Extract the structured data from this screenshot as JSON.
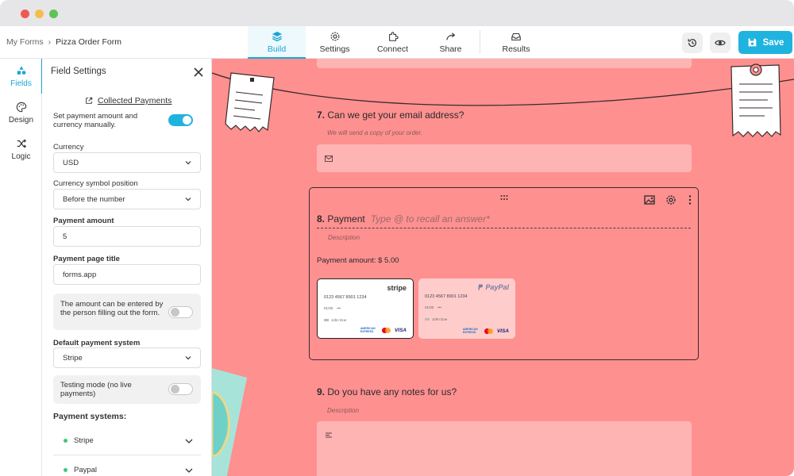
{
  "breadcrumb": {
    "root": "My Forms",
    "separator": "›",
    "current": "Pizza Order Form"
  },
  "tabs": [
    {
      "label": "Build",
      "icon": "stack-icon"
    },
    {
      "label": "Settings",
      "icon": "gear-icon"
    },
    {
      "label": "Connect",
      "icon": "puzzle-icon"
    },
    {
      "label": "Share",
      "icon": "share-arrow-icon"
    },
    {
      "label": "Results",
      "icon": "inbox-icon"
    }
  ],
  "save_label": "Save",
  "rail": [
    {
      "label": "Fields",
      "icon": "shapes-icon"
    },
    {
      "label": "Design",
      "icon": "palette-icon"
    },
    {
      "label": "Logic",
      "icon": "shuffle-icon"
    }
  ],
  "panel": {
    "title": "Field Settings",
    "collected_link": "Collected Payments",
    "manual_toggle_label": "Set payment amount and currency manually.",
    "currency_label": "Currency",
    "currency_value": "USD",
    "symbol_label": "Currency symbol position",
    "symbol_value": "Before the number",
    "amount_label": "Payment amount",
    "amount_value": "5",
    "page_title_label": "Payment page title",
    "page_title_value": "forms.app",
    "person_amount_label": "The amount can be entered by the person filling out the form.",
    "default_system_label": "Default payment system",
    "default_system_value": "Stripe",
    "testing_label": "Testing mode (no live payments)",
    "systems_label": "Payment systems:",
    "systems": [
      "Stripe",
      "Paypal"
    ]
  },
  "form": {
    "q7_number": "7.",
    "q7_title": "Can we get your email address?",
    "q7_desc": "We will send a copy of your order.",
    "q8_number": "8.",
    "q8_title": "Payment",
    "q8_placeholder": "Type @ to recall an answer*",
    "q8_desc": "Description",
    "q8_amount": "Payment amount: $ 5.00",
    "q9_number": "9.",
    "q9_title": "Do you have any notes for us?",
    "q9_desc": "Description"
  },
  "cards": {
    "stripe": {
      "brand": "stripe",
      "number": "0123 4567 8901 1234",
      "expiry": "01/30",
      "cvc": "•••",
      "holder": "John Doe",
      "amex": "AMERICAN EXPRESS",
      "visa": "VISA"
    },
    "paypal": {
      "brand": "PayPal",
      "number": "0123 4567 8901 1234",
      "expiry": "01/30",
      "cvc": "•••",
      "holder": "John Doe",
      "amex": "AMERICAN EXPRESS",
      "visa": "VISA"
    }
  },
  "colors": {
    "accent": "#1fb3e0",
    "canvas": "#ff9090",
    "field": "#ffb4b4"
  }
}
